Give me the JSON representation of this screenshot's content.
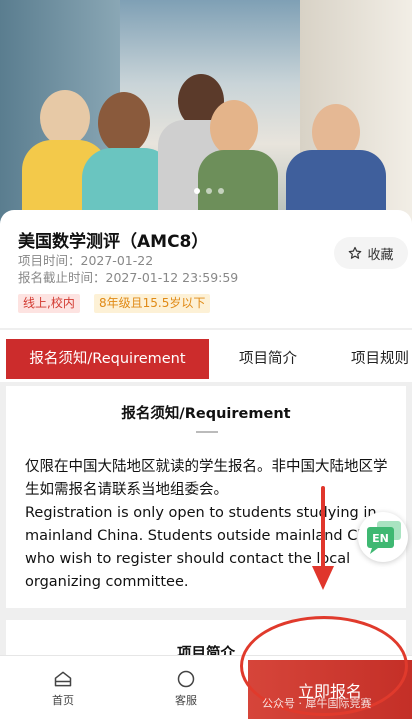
{
  "project": {
    "title": "美国数学测评（AMC8）",
    "time_label": "项目时间：2027-01-22",
    "deadline_label": "报名截止时间：2027-01-12 23:59:59",
    "tags": [
      "线上,校内",
      "8年级且15.5岁以下"
    ],
    "favorite_label": "收藏"
  },
  "tabs": [
    "报名须知/Requirement",
    "项目简介",
    "项目规则"
  ],
  "requirement": {
    "heading": "报名须知/Requirement",
    "text_cn": "仅限在中国大陆地区就读的学生报名。非中国大陆地区学生如需报名请联系当地组委会。",
    "text_en": "Registration is only open to students studying in mainland China. Students outside mainland China who wish to register should contact the local organizing committee."
  },
  "next_section": {
    "heading": "项目简介"
  },
  "floating": {
    "lang_label": "EN"
  },
  "bottom_bar": {
    "home_label": "首页",
    "service_label": "客服",
    "signup_label": "立即报名",
    "watermark": "公众号 · 犀牛国际竞赛"
  },
  "colors": {
    "accent": "#cc2c2c",
    "tag_red": "#d23a31",
    "tag_orange": "#e08a16",
    "chat_green": "#3fb872"
  }
}
